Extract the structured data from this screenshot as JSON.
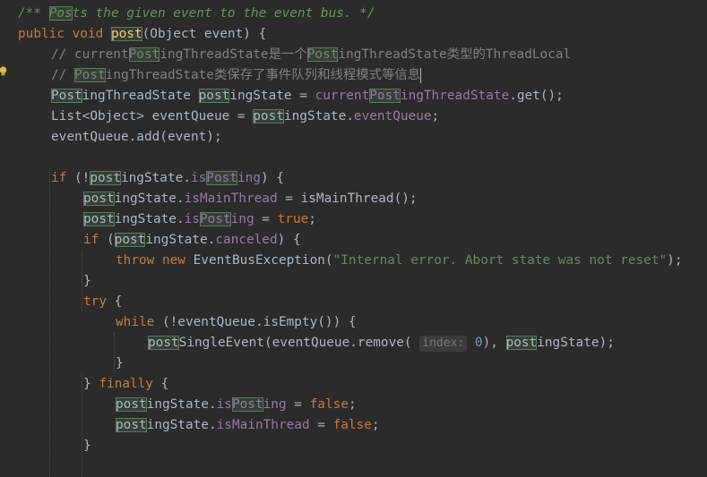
{
  "editor": {
    "lines": [
      {
        "indent": 20,
        "segs": [
          {
            "t": "/** ",
            "c": "doc"
          },
          {
            "t": "Pos",
            "c": "doc hl"
          },
          {
            "t": "ts the given event to the event bus. */",
            "c": "doc"
          }
        ]
      },
      {
        "indent": 20,
        "segs": [
          {
            "t": "public void ",
            "c": "kw"
          },
          {
            "t": "post",
            "c": "fn hl"
          },
          {
            "t": "(Object event) {"
          }
        ]
      },
      {
        "indent": 57,
        "segs": [
          {
            "t": "// current",
            "c": "cm"
          },
          {
            "t": "Post",
            "c": "cm hl"
          },
          {
            "t": "ingThreadState是一个",
            "c": "cm"
          },
          {
            "t": "Post",
            "c": "cm hl"
          },
          {
            "t": "ingThreadState类型的ThreadLocal",
            "c": "cm"
          }
        ]
      },
      {
        "indent": 57,
        "segs": [
          {
            "t": "// ",
            "c": "cm"
          },
          {
            "t": "Post",
            "c": "cm hl"
          },
          {
            "t": "ingThreadState类保存了事件队列和线程模式等信息",
            "c": "cm"
          },
          {
            "caret": true
          }
        ]
      },
      {
        "indent": 57,
        "segs": [
          {
            "t": "Post",
            "c": "hl"
          },
          {
            "t": "ingThreadState "
          },
          {
            "t": "post",
            "c": "hl"
          },
          {
            "t": "ingState = "
          },
          {
            "t": "current",
            "c": "fld"
          },
          {
            "t": "Post",
            "c": "fld hl"
          },
          {
            "t": "ingThreadState",
            "c": "fld"
          },
          {
            "t": ".get();"
          }
        ]
      },
      {
        "indent": 57,
        "segs": [
          {
            "t": "List<Object> eventQueue = "
          },
          {
            "t": "post",
            "c": "hl"
          },
          {
            "t": "ingState."
          },
          {
            "t": "eventQueue",
            "c": "fld"
          },
          {
            "t": ";"
          }
        ]
      },
      {
        "indent": 57,
        "segs": [
          {
            "t": "eventQueue.add(event);"
          }
        ]
      },
      {
        "indent": 57,
        "segs": []
      },
      {
        "indent": 57,
        "segs": [
          {
            "t": "if ",
            "c": "kw"
          },
          {
            "t": "(!"
          },
          {
            "t": "post",
            "c": "hl"
          },
          {
            "t": "ingState."
          },
          {
            "t": "is",
            "c": "fld"
          },
          {
            "t": "Post",
            "c": "fld hl"
          },
          {
            "t": "ing",
            "c": "fld"
          },
          {
            "t": ") {"
          }
        ]
      },
      {
        "indent": 93,
        "segs": [
          {
            "t": "post",
            "c": "hl"
          },
          {
            "t": "ingState."
          },
          {
            "t": "isMainThread",
            "c": "fld"
          },
          {
            "t": " = isMainThread();"
          }
        ]
      },
      {
        "indent": 93,
        "segs": [
          {
            "t": "post",
            "c": "hl"
          },
          {
            "t": "ingState."
          },
          {
            "t": "is",
            "c": "fld"
          },
          {
            "t": "Post",
            "c": "fld hl"
          },
          {
            "t": "ing",
            "c": "fld"
          },
          {
            "t": " = "
          },
          {
            "t": "true",
            "c": "kw"
          },
          {
            "t": ";"
          }
        ]
      },
      {
        "indent": 93,
        "segs": [
          {
            "t": "if ",
            "c": "kw"
          },
          {
            "t": "("
          },
          {
            "t": "post",
            "c": "hl"
          },
          {
            "t": "ingState."
          },
          {
            "t": "canceled",
            "c": "fld"
          },
          {
            "t": ") {"
          }
        ]
      },
      {
        "indent": 129,
        "segs": [
          {
            "t": "throw new ",
            "c": "kw"
          },
          {
            "t": "EventBusException("
          },
          {
            "t": "\"Internal error. Abort state was not reset\"",
            "c": "str"
          },
          {
            "t": ");"
          }
        ]
      },
      {
        "indent": 93,
        "segs": [
          {
            "t": "}"
          }
        ]
      },
      {
        "indent": 93,
        "segs": [
          {
            "t": "try ",
            "c": "kw"
          },
          {
            "t": "{"
          }
        ]
      },
      {
        "indent": 129,
        "segs": [
          {
            "t": "while ",
            "c": "kw"
          },
          {
            "t": "(!eventQueue.isEmpty()) {"
          }
        ]
      },
      {
        "indent": 165,
        "segs": [
          {
            "t": "post",
            "c": "hl"
          },
          {
            "t": "SingleEvent(eventQueue.remove( "
          },
          {
            "hint": "index:"
          },
          {
            "t": " "
          },
          {
            "t": "0",
            "c": "num"
          },
          {
            "t": "), "
          },
          {
            "t": "post",
            "c": "hl"
          },
          {
            "t": "ingState);"
          }
        ]
      },
      {
        "indent": 129,
        "segs": [
          {
            "t": "}"
          }
        ]
      },
      {
        "indent": 93,
        "segs": [
          {
            "t": "} "
          },
          {
            "t": "finally ",
            "c": "kw"
          },
          {
            "t": "{"
          }
        ]
      },
      {
        "indent": 129,
        "segs": [
          {
            "t": "post",
            "c": "hl"
          },
          {
            "t": "ingState."
          },
          {
            "t": "is",
            "c": "fld"
          },
          {
            "t": "Post",
            "c": "fld hl"
          },
          {
            "t": "ing",
            "c": "fld"
          },
          {
            "t": " = "
          },
          {
            "t": "false",
            "c": "kw"
          },
          {
            "t": ";"
          }
        ]
      },
      {
        "indent": 129,
        "segs": [
          {
            "t": "post",
            "c": "hl"
          },
          {
            "t": "ingState."
          },
          {
            "t": "isMainThread",
            "c": "fld"
          },
          {
            "t": " = "
          },
          {
            "t": "false",
            "c": "kw"
          },
          {
            "t": ";"
          }
        ]
      },
      {
        "indent": 93,
        "segs": [
          {
            "t": "}"
          }
        ]
      }
    ],
    "intention_icon": "lightbulb-icon"
  }
}
